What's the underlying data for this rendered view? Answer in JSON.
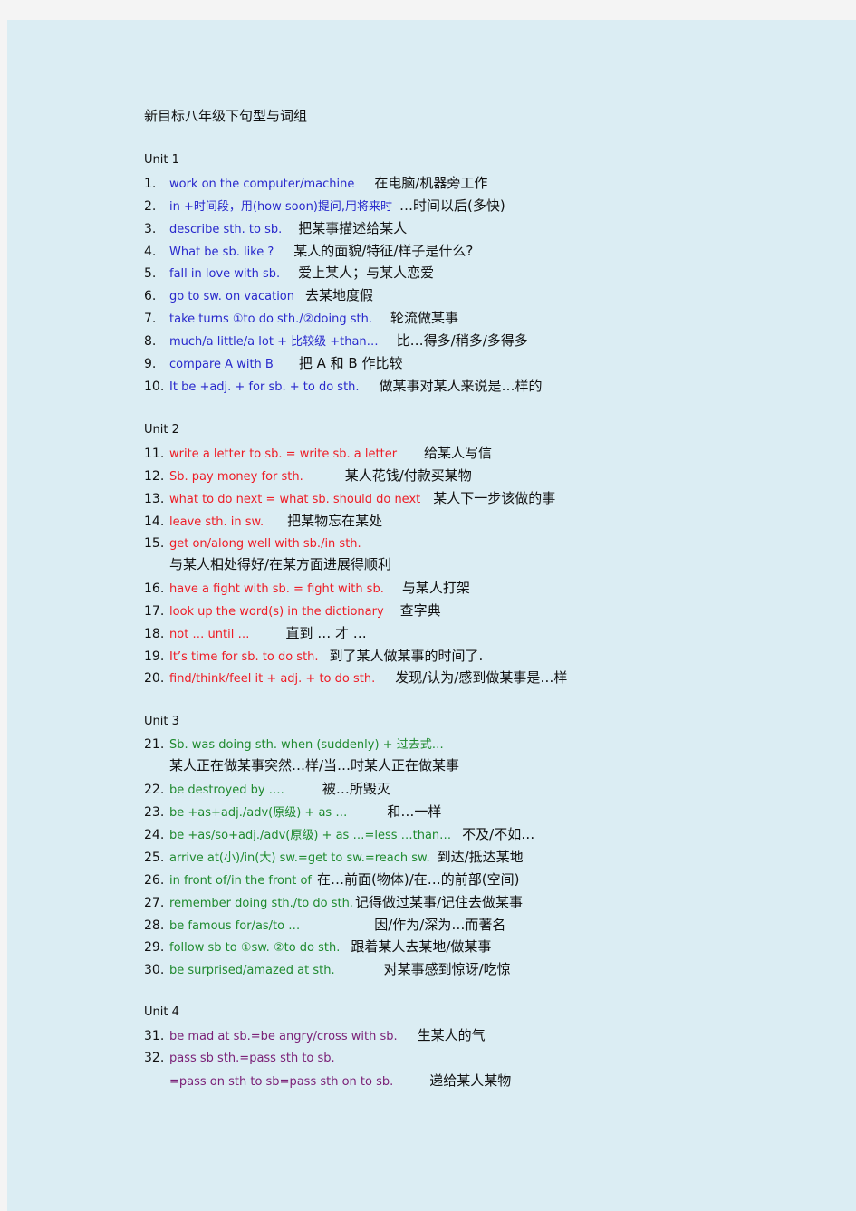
{
  "document": {
    "title": "新目标八年级下句型与词组",
    "colors": {
      "unit1": "#2929cc",
      "unit2": "#ee1c25",
      "unit3": "#1f8a2e",
      "unit4": "#7a1f76",
      "text": "#111111",
      "page_background": "#dbedf3",
      "outer_background": "#f4f4f4"
    },
    "units": [
      {
        "label": "Unit 1",
        "items": [
          {
            "num": "1.",
            "en": "work on the computer/machine",
            "cn": "在电脑/机器旁工作"
          },
          {
            "num": "2.",
            "en": "in +时间段，用(how soon)提问,用将来时",
            "cn": "…时间以后(多快)"
          },
          {
            "num": "3.",
            "en": "describe sth. to sb.",
            "cn": "把某事描述给某人"
          },
          {
            "num": "4.",
            "en": "What be sb. like ?",
            "cn": "某人的面貌/特征/样子是什么?"
          },
          {
            "num": "5.",
            "en": "fall in love with sb.",
            "cn": "爱上某人；与某人恋爱"
          },
          {
            "num": "6.",
            "en": "go to sw. on vacation",
            "cn": "去某地度假"
          },
          {
            "num": "7.",
            "en": "take turns ①to do sth./②doing sth.",
            "cn": "轮流做某事"
          },
          {
            "num": "8.",
            "en": "much/a little/a lot + 比较级 +than…",
            "cn": "比…得多/稍多/多得多"
          },
          {
            "num": "9.",
            "en": "compare A with B",
            "cn": "把 A 和 B 作比较"
          },
          {
            "num": "10.",
            "en": "It be +adj. + for sb. + to do sth.",
            "cn": "做某事对某人来说是…样的"
          }
        ]
      },
      {
        "label": "Unit 2",
        "items": [
          {
            "num": "11.",
            "en": "write a letter to sb. = write sb. a letter",
            "cn": "给某人写信"
          },
          {
            "num": "12.",
            "en": "Sb. pay money for sth.",
            "cn": "某人花钱/付款买某物"
          },
          {
            "num": "13.",
            "en": "what to do next = what sb. should do next",
            "cn": "某人下一步该做的事"
          },
          {
            "num": "14.",
            "en": "leave sth. in sw.",
            "cn": "把某物忘在某处"
          },
          {
            "num": "15.",
            "en": "get on/along well with sb./in sth.",
            "cn": "与某人相处得好/在某方面进展得顺利"
          },
          {
            "num": "16.",
            "en": "have a fight with sb. = fight with sb.",
            "cn": "与某人打架"
          },
          {
            "num": "17.",
            "en": "look up the word(s) in the dictionary",
            "cn": "查字典"
          },
          {
            "num": "18.",
            "en": "not … until …",
            "cn": "直到 … 才 …"
          },
          {
            "num": "19.",
            "en": "It’s time for sb. to do sth.",
            "cn": "到了某人做某事的时间了."
          },
          {
            "num": "20.",
            "en": "find/think/feel it + adj. + to do sth.",
            "cn": "发现/认为/感到做某事是…样"
          }
        ]
      },
      {
        "label": "Unit 3",
        "items": [
          {
            "num": "21.",
            "en": "Sb. was doing sth. when (suddenly) + 过去式…",
            "cn": "某人正在做某事突然…样/当…时某人正在做某事"
          },
          {
            "num": "22.",
            "en": "be destroyed by ….",
            "cn": "被…所毁灭"
          },
          {
            "num": "23.",
            "en": "be +as+adj./adv(原级) + as …",
            "cn": "和…一样"
          },
          {
            "num": "24.",
            "en": "be +as/so+adj./adv(原级) + as …=less …than…",
            "cn": "不及/不如…"
          },
          {
            "num": "25.",
            "en": "arrive at(小)/in(大) sw.=get to sw.=reach sw.",
            "cn": "到达/抵达某地"
          },
          {
            "num": "26.",
            "en": "in front of/in the front of",
            "cn": "在…前面(物体)/在…的前部(空间)"
          },
          {
            "num": "27.",
            "en": "remember doing sth./to do sth.",
            "cn": "记得做过某事/记住去做某事"
          },
          {
            "num": "28.",
            "en": "be famous for/as/to …",
            "cn": "因/作为/深为…而著名"
          },
          {
            "num": "29.",
            "en": "follow sb to ①sw. ②to do sth.",
            "cn": "跟着某人去某地/做某事"
          },
          {
            "num": "30.",
            "en": "be surprised/amazed at sth.",
            "cn": "对某事感到惊讶/吃惊"
          }
        ]
      },
      {
        "label": "Unit 4",
        "items": [
          {
            "num": "31.",
            "en": "be mad at sb.=be angry/cross with sb.",
            "cn": "生某人的气"
          },
          {
            "num": "32.",
            "en": "pass sb sth.=pass sth to sb.",
            "en2": "=pass on sth to sb=pass sth on to sb.",
            "cn": "递给某人某物"
          }
        ]
      }
    ]
  }
}
